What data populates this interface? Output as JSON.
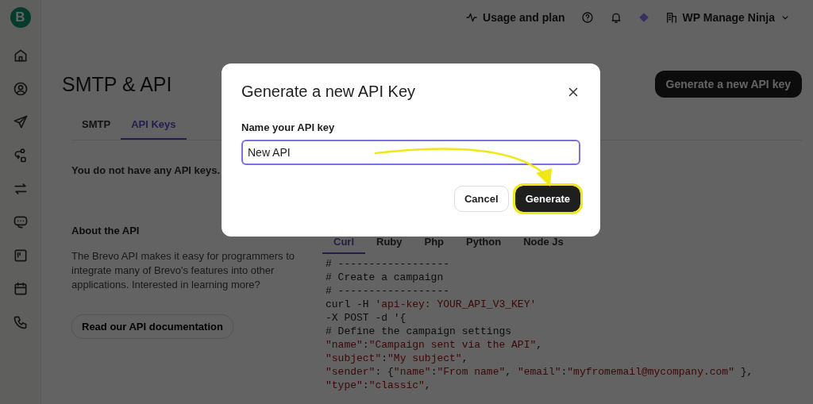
{
  "sidebar": {
    "logo": "B"
  },
  "header": {
    "usage": "Usage and plan",
    "account": "WP Manage Ninja"
  },
  "page": {
    "title": "SMTP & API",
    "primary_button": "Generate a new API key",
    "tabs": [
      {
        "label": "SMTP",
        "selected": false
      },
      {
        "label": "API Keys",
        "selected": true
      }
    ],
    "empty_message": "You do not have any API keys.",
    "about": {
      "heading": "About the API",
      "text": "The Brevo API makes it easy for programmers to integrate many of Brevo's features into other applications. Interested in learning more?",
      "button": "Read our API documentation"
    },
    "code_tabs": [
      {
        "label": "Curl",
        "selected": true
      },
      {
        "label": "Ruby",
        "selected": false
      },
      {
        "label": "Php",
        "selected": false
      },
      {
        "label": "Python",
        "selected": false
      },
      {
        "label": "Node Js",
        "selected": false
      }
    ],
    "code_lines": [
      [
        {
          "kind": "plain",
          "text": "# ------------------"
        }
      ],
      [
        {
          "kind": "plain",
          "text": "# Create a campaign"
        }
      ],
      [
        {
          "kind": "plain",
          "text": "# ------------------"
        }
      ],
      [
        {
          "kind": "plain",
          "text": "curl -H "
        },
        {
          "kind": "string",
          "text": "'api-key: YOUR_API_V3_KEY'"
        }
      ],
      [
        {
          "kind": "plain",
          "text": "-X POST -d '{"
        }
      ],
      [
        {
          "kind": "plain",
          "text": "# Define the campaign settings"
        }
      ],
      [
        {
          "kind": "string",
          "text": "\"name\""
        },
        {
          "kind": "plain",
          "text": ":"
        },
        {
          "kind": "string",
          "text": "\"Campaign sent via the API\""
        },
        {
          "kind": "plain",
          "text": ","
        }
      ],
      [
        {
          "kind": "string",
          "text": "\"subject\""
        },
        {
          "kind": "plain",
          "text": ":"
        },
        {
          "kind": "string",
          "text": "\"My subject\""
        },
        {
          "kind": "plain",
          "text": ","
        }
      ],
      [
        {
          "kind": "string",
          "text": "\"sender\""
        },
        {
          "kind": "plain",
          "text": ": {"
        },
        {
          "kind": "string",
          "text": "\"name\""
        },
        {
          "kind": "plain",
          "text": ":"
        },
        {
          "kind": "string",
          "text": "\"From name\""
        },
        {
          "kind": "plain",
          "text": ", "
        },
        {
          "kind": "string",
          "text": "\"email\""
        },
        {
          "kind": "plain",
          "text": ":"
        },
        {
          "kind": "string",
          "text": "\"myfromemail@mycompany.com\""
        },
        {
          "kind": "plain",
          "text": " },"
        }
      ],
      [
        {
          "kind": "string",
          "text": "\"type\""
        },
        {
          "kind": "plain",
          "text": ":"
        },
        {
          "kind": "string",
          "text": "\"classic\""
        },
        {
          "kind": "plain",
          "text": ","
        }
      ]
    ]
  },
  "dialog": {
    "title": "Generate a new API Key",
    "field_label": "Name your API key",
    "field_value": "New API",
    "buttons": [
      {
        "label": "Cancel",
        "kind": "secondary",
        "highlighted": false
      },
      {
        "label": "Generate",
        "kind": "primary",
        "highlighted": true
      }
    ]
  }
}
